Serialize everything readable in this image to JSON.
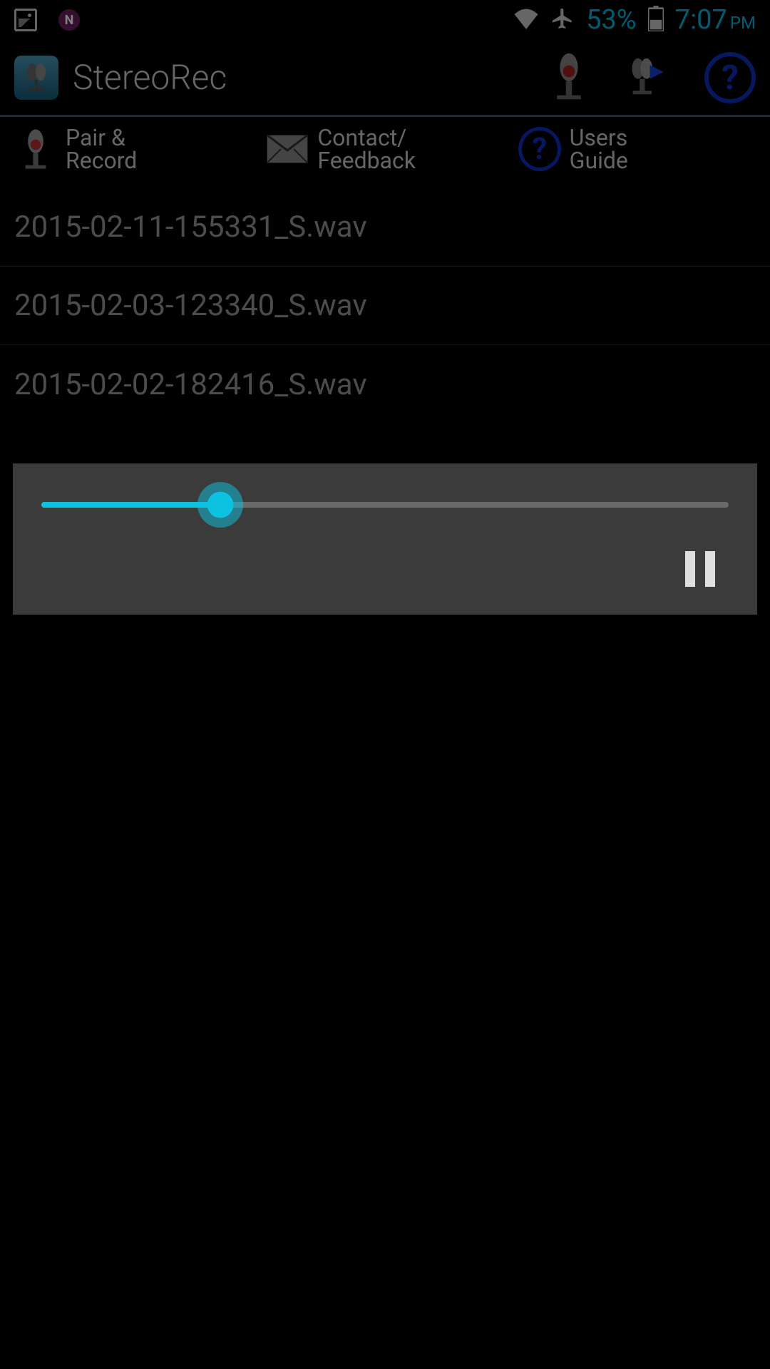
{
  "status_bar": {
    "notification_n": "N",
    "battery_percent": "53%",
    "time": "7:07",
    "ampm": "PM"
  },
  "header": {
    "app_title": "StereoRec"
  },
  "tabs": {
    "pair_record": "Pair &\nRecord",
    "contact_feedback": "Contact/\nFeedback",
    "users_guide": "Users\nGuide"
  },
  "files": [
    "2015-02-11-155331_S.wav",
    "2015-02-03-123340_S.wav",
    "2015-02-02-182416_S.wav"
  ],
  "player": {
    "progress_percent": 26
  }
}
